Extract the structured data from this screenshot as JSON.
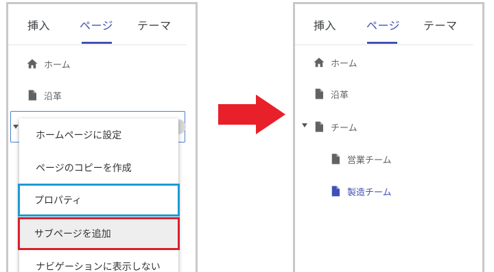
{
  "left_panel": {
    "tabs": [
      {
        "label": "挿入"
      },
      {
        "label": "ページ",
        "active": true
      },
      {
        "label": "テーマ"
      }
    ],
    "pages": [
      {
        "label": "ホーム",
        "icon": "home-icon"
      },
      {
        "label": "沿革",
        "icon": "document-icon"
      }
    ],
    "context_menu": [
      {
        "label": "ホームページに設定"
      },
      {
        "label": "ページのコピーを作成"
      },
      {
        "label": "プロパティ",
        "highlight": "blue"
      },
      {
        "label": "サブページを追加",
        "highlight": "red"
      },
      {
        "label": "ナビゲーションに表示しない"
      }
    ]
  },
  "right_panel": {
    "tabs": [
      {
        "label": "挿入"
      },
      {
        "label": "ページ",
        "active": true
      },
      {
        "label": "テーマ"
      }
    ],
    "pages": [
      {
        "label": "ホーム",
        "icon": "home-icon"
      },
      {
        "label": "沿革",
        "icon": "document-icon"
      },
      {
        "label": "チーム",
        "icon": "document-icon",
        "expanded": true
      },
      {
        "label": "営業チーム",
        "icon": "document-icon",
        "level": 1
      },
      {
        "label": "製造チーム",
        "icon": "document-icon",
        "level": 1,
        "active": true
      }
    ]
  },
  "colors": {
    "accent": "#3f51b5",
    "arrow": "#e8202a",
    "highlight_blue": "#1b9bd1",
    "highlight_red": "#d9202b"
  }
}
